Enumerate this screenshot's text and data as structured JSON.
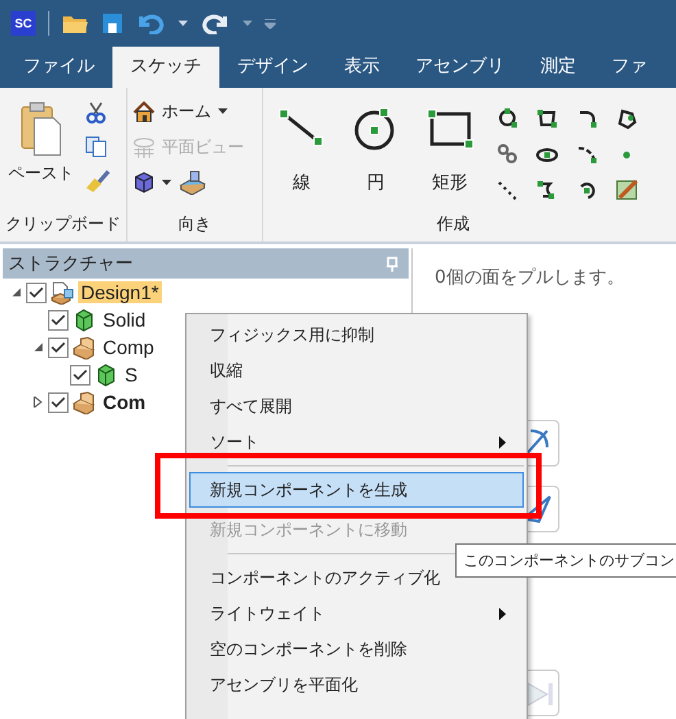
{
  "app_logo": "SC",
  "tabs": [
    {
      "label": "ファイル",
      "selected": false
    },
    {
      "label": "スケッチ",
      "selected": true
    },
    {
      "label": "デザイン",
      "selected": false
    },
    {
      "label": "表示",
      "selected": false
    },
    {
      "label": "アセンブリ",
      "selected": false
    },
    {
      "label": "測定",
      "selected": false
    },
    {
      "label": "ファ",
      "selected": false
    }
  ],
  "ribbon_groups": [
    {
      "kind": "clipboard",
      "label": "クリップボード",
      "items": [
        {
          "label": "ペースト",
          "disabled": false
        }
      ]
    },
    {
      "kind": "orient",
      "label": "向き",
      "items": [
        {
          "label": "ホーム",
          "disabled": false
        },
        {
          "label": "平面ビュー",
          "disabled": true
        }
      ]
    },
    {
      "kind": "create",
      "label": "作成",
      "items": [
        {
          "label": "線",
          "kind": "line"
        },
        {
          "label": "円",
          "kind": "circle"
        },
        {
          "label": "矩形",
          "kind": "rect"
        }
      ]
    }
  ],
  "structure": {
    "title": "ストラクチャー",
    "tree": [
      {
        "label": "Design1*",
        "kind": "design",
        "checked": true,
        "expanded": true,
        "selected": true,
        "bold": false,
        "children": [
          {
            "label": "Solid",
            "kind": "solid",
            "checked": true,
            "selected": false,
            "bold": false
          },
          {
            "label": "Comp",
            "kind": "component",
            "checked": true,
            "expanded": true,
            "selected": false,
            "bold": false,
            "children": [
              {
                "label": "S",
                "kind": "solid",
                "checked": true,
                "selected": false,
                "bold": false
              }
            ]
          },
          {
            "label": "Com",
            "kind": "component",
            "checked": true,
            "expanded": false,
            "selected": false,
            "bold": true
          }
        ]
      }
    ]
  },
  "design_pane": {
    "message": "0個の面をプルします。"
  },
  "context_menu": [
    {
      "kind": "item",
      "label": "フィジックス用に抑制",
      "disabled": false,
      "selected": false,
      "submenu": false
    },
    {
      "kind": "item",
      "label": "収縮",
      "disabled": false,
      "selected": false,
      "submenu": false
    },
    {
      "kind": "item",
      "label": "すべて展開",
      "disabled": false,
      "selected": false,
      "submenu": false
    },
    {
      "kind": "item",
      "label": "ソート",
      "disabled": false,
      "selected": false,
      "submenu": true
    },
    {
      "kind": "separator"
    },
    {
      "kind": "item",
      "label": "新規コンポーネントを生成",
      "disabled": false,
      "selected": true,
      "submenu": false
    },
    {
      "kind": "item",
      "label": "新規コンポーネントに移動",
      "disabled": true,
      "selected": false,
      "submenu": false
    },
    {
      "kind": "separator"
    },
    {
      "kind": "item",
      "label": "コンポーネントのアクティブ化",
      "disabled": false,
      "selected": false,
      "submenu": false
    },
    {
      "kind": "item",
      "label": "ライトウェイト",
      "disabled": false,
      "selected": false,
      "submenu": true
    },
    {
      "kind": "item",
      "label": "空のコンポーネントを削除",
      "disabled": false,
      "selected": false,
      "submenu": false
    },
    {
      "kind": "item",
      "label": "アセンブリを平面化",
      "disabled": false,
      "selected": false,
      "submenu": false
    }
  ],
  "tooltip": "このコンポーネントのサブコン"
}
